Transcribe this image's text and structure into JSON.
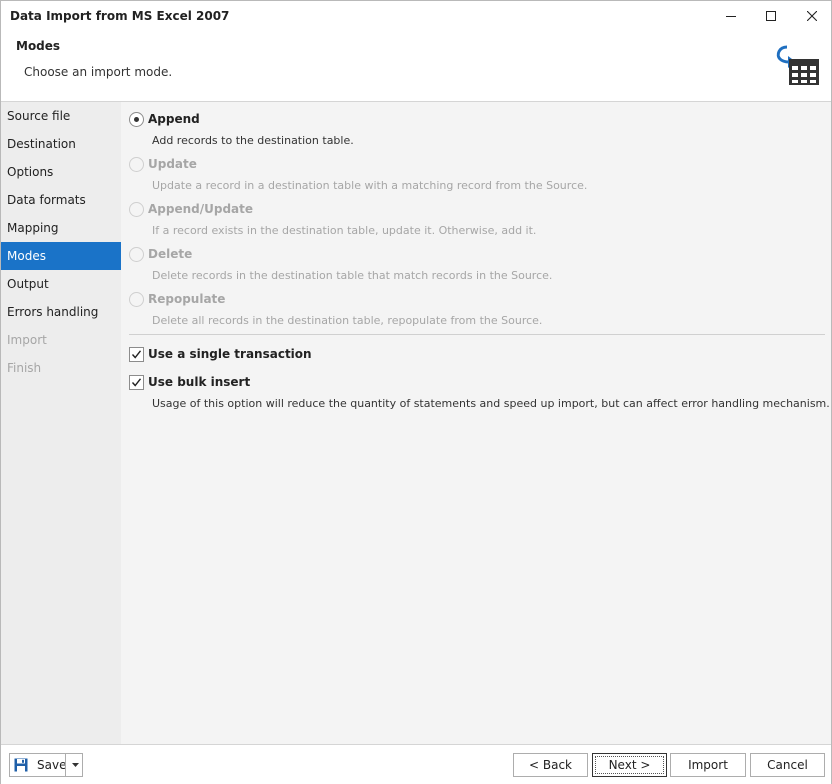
{
  "window": {
    "title": "Data Import from MS Excel 2007"
  },
  "header": {
    "title": "Modes",
    "subtitle": "Choose an import mode."
  },
  "sidebar": {
    "items": [
      {
        "label": "Source file",
        "state": "normal"
      },
      {
        "label": "Destination",
        "state": "normal"
      },
      {
        "label": "Options",
        "state": "normal"
      },
      {
        "label": "Data formats",
        "state": "normal"
      },
      {
        "label": "Mapping",
        "state": "normal"
      },
      {
        "label": "Modes",
        "state": "active"
      },
      {
        "label": "Output",
        "state": "normal"
      },
      {
        "label": "Errors handling",
        "state": "normal"
      },
      {
        "label": "Import",
        "state": "disabled"
      },
      {
        "label": "Finish",
        "state": "disabled"
      }
    ]
  },
  "modes": {
    "selected": "Append",
    "options": [
      {
        "label": "Append",
        "description": "Add records to the destination table.",
        "enabled": true
      },
      {
        "label": "Update",
        "description": "Update a record in a destination table with a matching record from the Source.",
        "enabled": false
      },
      {
        "label": "Append/Update",
        "description": "If a record exists in the destination table, update it. Otherwise, add it.",
        "enabled": false
      },
      {
        "label": "Delete",
        "description": "Delete records in the destination table that match records in the Source.",
        "enabled": false
      },
      {
        "label": "Repopulate",
        "description": "Delete all records in the destination table, repopulate from the Source.",
        "enabled": false
      }
    ]
  },
  "transaction": {
    "label": "Use a single transaction",
    "checked": true
  },
  "bulk_insert": {
    "label": "Use bulk insert",
    "checked": true,
    "description": "Usage of this option will reduce the quantity of statements and speed up import, but can affect error handling mechanism."
  },
  "footer": {
    "save_label": "Save",
    "back_label": "< Back",
    "next_label": "Next >",
    "import_label": "Import",
    "cancel_label": "Cancel"
  },
  "colors": {
    "accent": "#1a73c8",
    "sidebar_bg": "#ededed",
    "content_bg": "#f4f4f4",
    "disabled_text": "#a6a6a6"
  },
  "icons": {
    "window": [
      "minimize-icon",
      "maximize-icon",
      "close-icon"
    ],
    "header": "import-table-icon",
    "footer": [
      "save-icon",
      "chevron-down-icon"
    ]
  }
}
